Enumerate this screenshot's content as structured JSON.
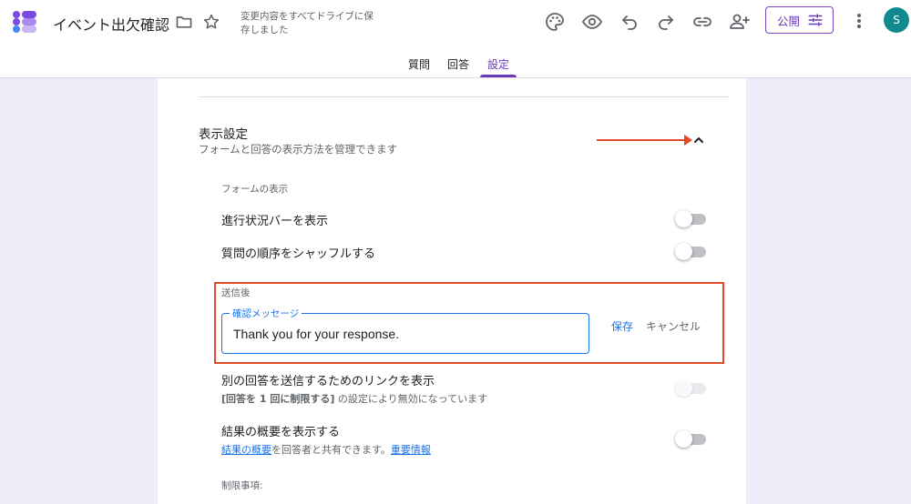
{
  "app": {
    "title": "イベント出欠確認",
    "save_status": "変更内容をすべてドライブに保存しました"
  },
  "header": {
    "publish_label": "公開",
    "avatar_initial": "S",
    "icons": [
      "palette-icon",
      "eye-icon",
      "undo-icon",
      "redo-icon",
      "link-icon",
      "add-person-icon",
      "tune-icon",
      "more-vert-icon"
    ]
  },
  "tabs": [
    {
      "label": "質問",
      "active": false
    },
    {
      "label": "回答",
      "active": false
    },
    {
      "label": "設定",
      "active": true
    }
  ],
  "display_settings": {
    "title": "表示設定",
    "subtitle": "フォームと回答の表示方法を管理できます",
    "form_display_label": "フォームの表示",
    "show_progress_bar": {
      "label": "進行状況バーを表示",
      "on": false
    },
    "shuffle_questions": {
      "label": "質問の順序をシャッフルする",
      "on": false
    },
    "after_submit_label": "送信後",
    "confirmation": {
      "label": "確認メッセージ",
      "value": "Thank you for your response.",
      "save_label": "保存",
      "cancel_label": "キャンセル"
    },
    "another_response": {
      "label": "別の回答を送信するためのリンクを表示",
      "note_bold": "[回答を 1 回に制限する]",
      "note_rest": " の設定により無効になっています",
      "on": false,
      "disabled": true
    },
    "results_summary": {
      "label": "結果の概要を表示する",
      "link1": "結果の概要",
      "text_mid": "を回答者と共有できます。",
      "link2": "重要情報",
      "on": false
    },
    "restrictions_label": "制限事項:"
  },
  "colors": {
    "accent": "#673ab7",
    "link": "#1a73e8",
    "highlight": "#e04a2a",
    "avatar": "#118a8f"
  }
}
